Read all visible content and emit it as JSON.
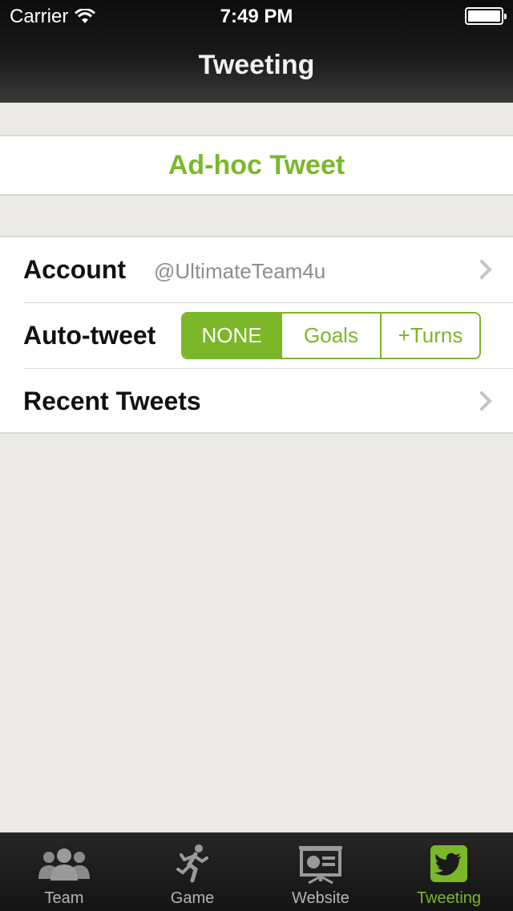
{
  "status_bar": {
    "carrier": "Carrier",
    "time": "7:49 PM"
  },
  "nav": {
    "title": "Tweeting"
  },
  "adhoc": {
    "label": "Ad-hoc Tweet"
  },
  "settings": {
    "account": {
      "label": "Account",
      "value": "@UltimateTeam4u"
    },
    "auto_tweet": {
      "label": "Auto-tweet",
      "options": [
        "NONE",
        "Goals",
        "+Turns"
      ],
      "selected": "NONE"
    },
    "recent": {
      "label": "Recent Tweets"
    }
  },
  "tabs": [
    {
      "label": "Team",
      "icon": "team-icon"
    },
    {
      "label": "Game",
      "icon": "runner-icon"
    },
    {
      "label": "Website",
      "icon": "presentation-icon"
    },
    {
      "label": "Tweeting",
      "icon": "twitter-icon",
      "active": true
    }
  ],
  "colors": {
    "accent": "#7cb72a",
    "nav_bg": "#1a1a1a",
    "page_bg": "#ebeae6"
  }
}
